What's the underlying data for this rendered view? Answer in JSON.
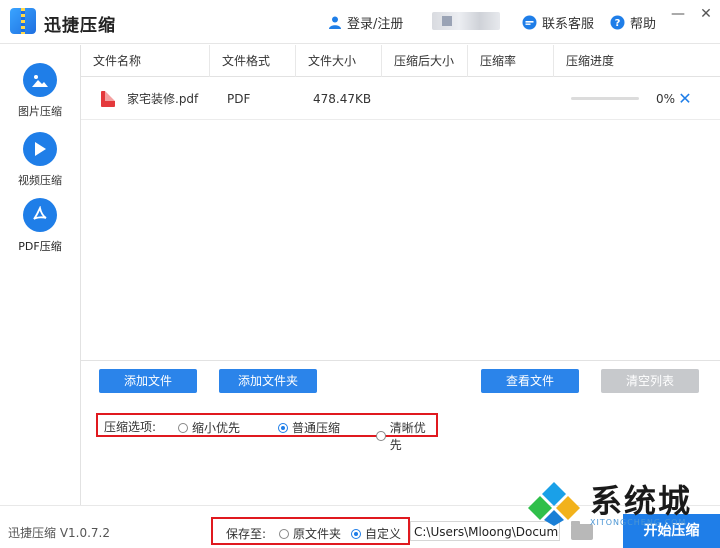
{
  "app": {
    "title": "迅捷压缩",
    "version": "迅捷压缩 V1.0.7.2"
  },
  "titlebar": {
    "login": "登录/注册",
    "support": "联系客服",
    "help": "帮助"
  },
  "sidebar": {
    "items": [
      {
        "label": "图片压缩",
        "icon": "image-icon"
      },
      {
        "label": "视频压缩",
        "icon": "play-icon"
      },
      {
        "label": "PDF压缩",
        "icon": "pdf-icon",
        "active": true
      }
    ]
  },
  "table": {
    "headers": [
      "文件名称",
      "文件格式",
      "文件大小",
      "压缩后大小",
      "压缩率",
      "压缩进度"
    ],
    "rows": [
      {
        "name": "家宅装修.pdf",
        "format": "PDF",
        "size": "478.47KB",
        "compressed_size": "",
        "ratio": "",
        "progress": "0%",
        "progress_value": 0
      }
    ]
  },
  "buttons": {
    "add_file": "添加文件",
    "add_folder": "添加文件夹",
    "view_file": "查看文件",
    "clear_list": "清空列表"
  },
  "options": {
    "label": "压缩选项:",
    "choices": [
      {
        "label": "缩小优先",
        "selected": false
      },
      {
        "label": "普通压缩",
        "selected": true
      },
      {
        "label": "清晰优先",
        "selected": false
      }
    ]
  },
  "footer": {
    "save_label": "保存至:",
    "save_choices": [
      {
        "label": "原文件夹",
        "selected": false
      },
      {
        "label": "自定义",
        "selected": true
      }
    ],
    "path": "C:\\Users\\Mloong\\Documents",
    "start_label": "开始压缩"
  },
  "watermark": {
    "text": "系统城",
    "sub": "XITONGCHENG.COM"
  },
  "colors": {
    "accent": "#1f7ee8",
    "highlight_border": "#e0191f"
  }
}
